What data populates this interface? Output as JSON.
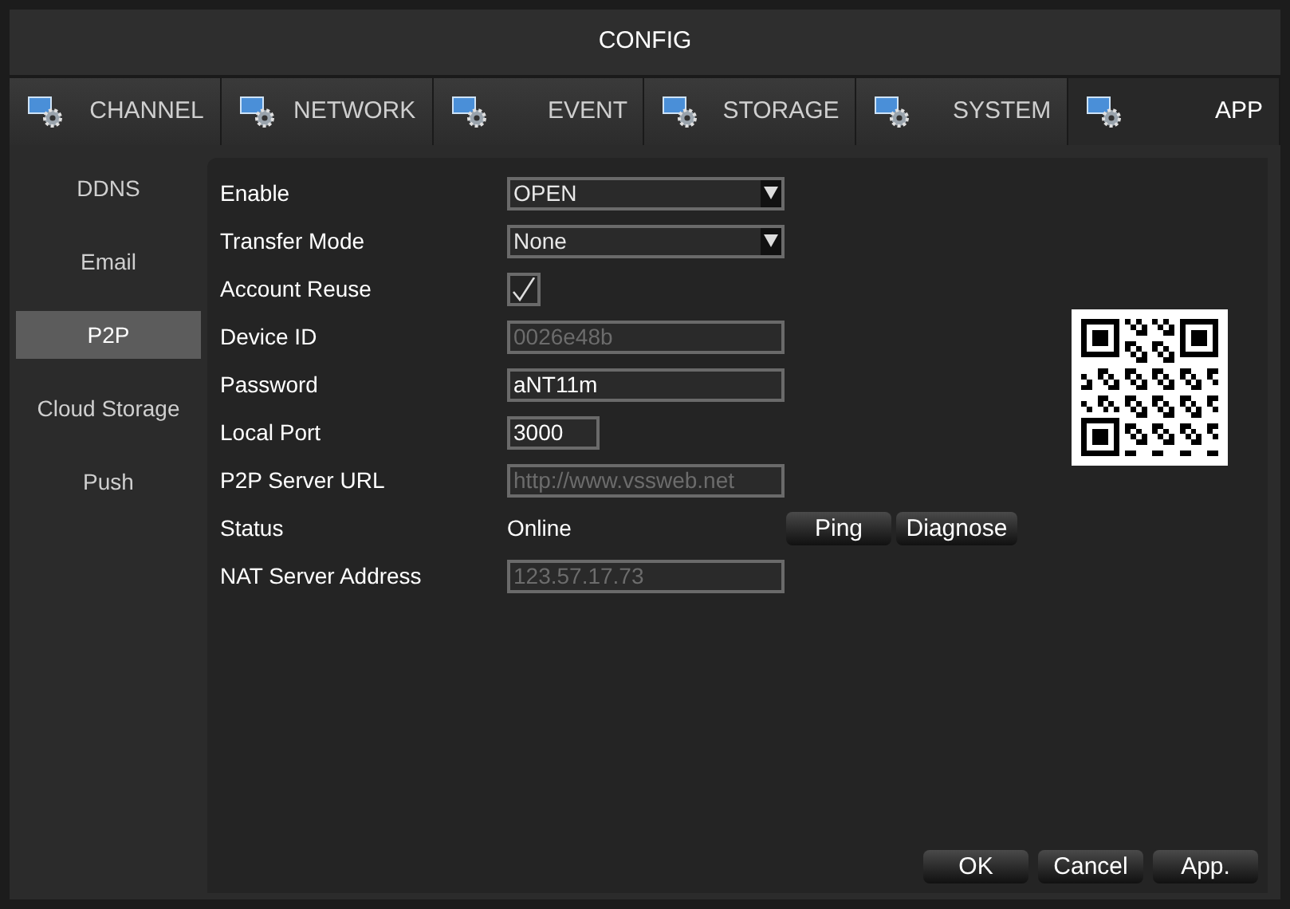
{
  "window": {
    "title": "CONFIG"
  },
  "tabs": [
    {
      "label": "CHANNEL",
      "selected": false
    },
    {
      "label": "NETWORK",
      "selected": false
    },
    {
      "label": "EVENT",
      "selected": false
    },
    {
      "label": "STORAGE",
      "selected": false
    },
    {
      "label": "SYSTEM",
      "selected": false
    },
    {
      "label": "APP",
      "selected": true
    }
  ],
  "sidebar": {
    "items": [
      {
        "label": "DDNS",
        "selected": false
      },
      {
        "label": "Email",
        "selected": false
      },
      {
        "label": "P2P",
        "selected": true
      },
      {
        "label": "Cloud Storage",
        "selected": false
      },
      {
        "label": "Push",
        "selected": false
      }
    ]
  },
  "form": [
    {
      "kind": "select",
      "label": "Enable",
      "value": "OPEN"
    },
    {
      "kind": "select",
      "label": "Transfer Mode",
      "value": "None"
    },
    {
      "kind": "checkbox",
      "label": "Account Reuse",
      "checked": true
    },
    {
      "kind": "input",
      "label": "Device ID",
      "value": "0026e48b",
      "disabled": true
    },
    {
      "kind": "input",
      "label": "Password",
      "value": "aNT11m",
      "disabled": false
    },
    {
      "kind": "short_input",
      "label": "Local Port",
      "value": "3000",
      "disabled": false
    },
    {
      "kind": "input",
      "label": "P2P Server URL",
      "value": "http://www.vssweb.net",
      "disabled": true
    },
    {
      "kind": "status",
      "label": "Status",
      "value": "Online",
      "buttons": [
        "Ping",
        "Diagnose"
      ]
    },
    {
      "kind": "input",
      "label": "NAT Server Address",
      "value": "123.57.17.73",
      "disabled": true
    }
  ],
  "buttons": [
    "OK",
    "Cancel",
    "App."
  ]
}
